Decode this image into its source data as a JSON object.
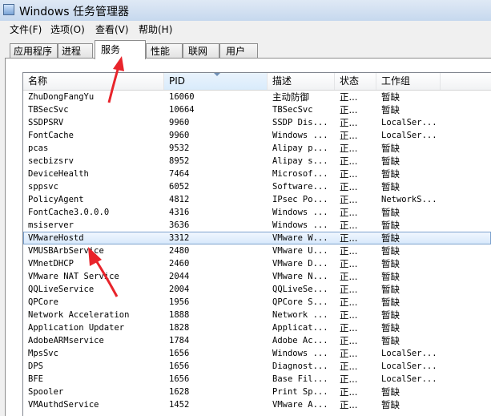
{
  "window": {
    "title": "Windows 任务管理器"
  },
  "menu": [
    "文件(F)",
    "选项(O)",
    "查看(V)",
    "帮助(H)"
  ],
  "tabs": [
    {
      "label": "应用程序"
    },
    {
      "label": "进程"
    },
    {
      "label": "服务",
      "active": true
    },
    {
      "label": "性能"
    },
    {
      "label": "联网"
    },
    {
      "label": "用户"
    }
  ],
  "table": {
    "columns": [
      "名称",
      "PID",
      "描述",
      "状态",
      "工作组"
    ],
    "sorted_column": "PID",
    "selected_index": 11,
    "rows": [
      [
        "ZhuDongFangYu",
        "16060",
        "主动防御",
        "正...",
        "暂缺"
      ],
      [
        "TBSecSvc",
        "10664",
        "TBSecSvc",
        "正...",
        "暂缺"
      ],
      [
        "SSDPSRV",
        "9960",
        "SSDP Dis...",
        "正...",
        "LocalSer..."
      ],
      [
        "FontCache",
        "9960",
        "Windows ...",
        "正...",
        "LocalSer..."
      ],
      [
        "pcas",
        "9532",
        "Alipay p...",
        "正...",
        "暂缺"
      ],
      [
        "secbizsrv",
        "8952",
        "Alipay s...",
        "正...",
        "暂缺"
      ],
      [
        "DeviceHealth",
        "7464",
        "Microsof...",
        "正...",
        "暂缺"
      ],
      [
        "sppsvc",
        "6052",
        "Software...",
        "正...",
        "暂缺"
      ],
      [
        "PolicyAgent",
        "4812",
        "IPsec Po...",
        "正...",
        "NetworkS..."
      ],
      [
        "FontCache3.0.0.0",
        "4316",
        "Windows ...",
        "正...",
        "暂缺"
      ],
      [
        "msiserver",
        "3636",
        "Windows ...",
        "正...",
        "暂缺"
      ],
      [
        "VMwareHostd",
        "3312",
        "VMware W...",
        "正...",
        "暂缺"
      ],
      [
        "VMUSBArbService",
        "2480",
        "VMware U...",
        "正...",
        "暂缺"
      ],
      [
        "VMnetDHCP",
        "2460",
        "VMware D...",
        "正...",
        "暂缺"
      ],
      [
        "VMware NAT Service",
        "2044",
        "VMware N...",
        "正...",
        "暂缺"
      ],
      [
        "QQLiveService",
        "2004",
        "QQLiveSe...",
        "正...",
        "暂缺"
      ],
      [
        "QPCore",
        "1956",
        "QPCore S...",
        "正...",
        "暂缺"
      ],
      [
        "Network Acceleration",
        "1888",
        "Network ...",
        "正...",
        "暂缺"
      ],
      [
        "Application Updater",
        "1828",
        "Applicat...",
        "正...",
        "暂缺"
      ],
      [
        "AdobeARMservice",
        "1784",
        "Adobe Ac...",
        "正...",
        "暂缺"
      ],
      [
        "MpsSvc",
        "1656",
        "Windows ...",
        "正...",
        "LocalSer..."
      ],
      [
        "DPS",
        "1656",
        "Diagnost...",
        "正...",
        "LocalSer..."
      ],
      [
        "BFE",
        "1656",
        "Base Fil...",
        "正...",
        "LocalSer..."
      ],
      [
        "Spooler",
        "1628",
        "Print Sp...",
        "正...",
        "暂缺"
      ],
      [
        "VMAuthdService",
        "1452",
        "VMware A...",
        "正...",
        "暂缺"
      ]
    ]
  },
  "colors": {
    "annotation_arrow": "#e8242b",
    "selection_border": "#7da2ce"
  }
}
